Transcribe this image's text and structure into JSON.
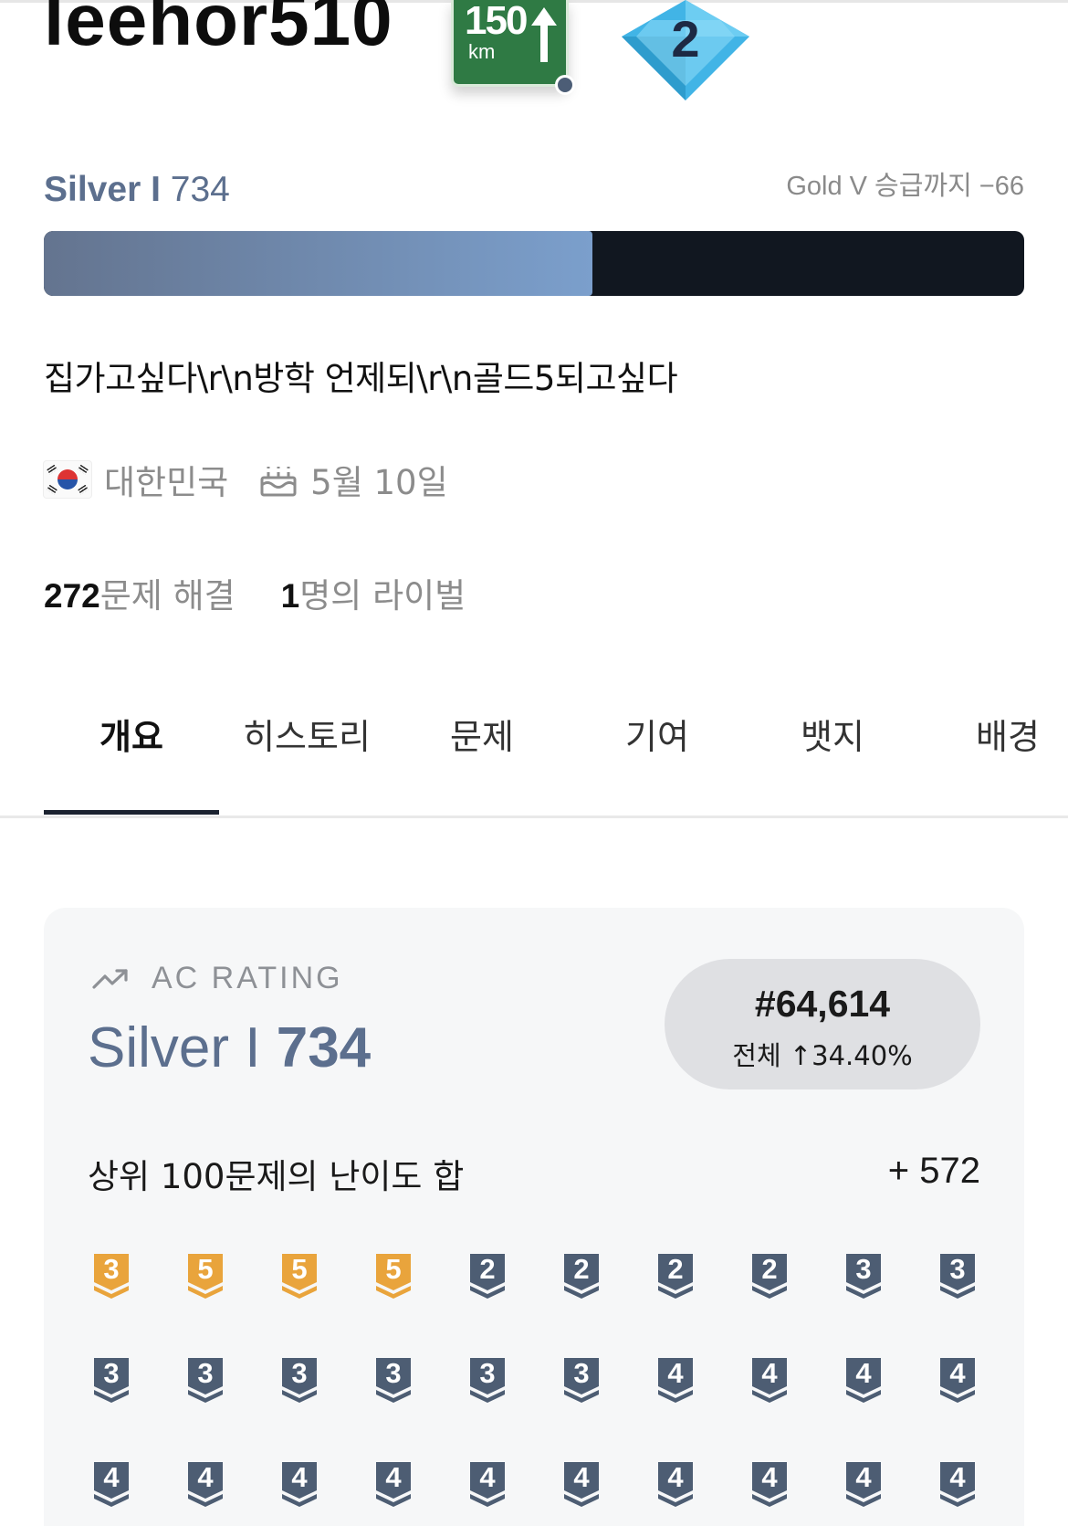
{
  "profile": {
    "handle": "leehor510",
    "sign_number": "150",
    "sign_unit": "km",
    "badge_level": "2",
    "tier_name": "Silver I",
    "rating": "734",
    "promotion_text": "Gold V 승급까지 −66",
    "rating_progress": 0.56,
    "bio": "집가고싶다\\r\\n방학 언제되\\r\\n골드5되고싶다",
    "country": "대한민국",
    "birthday": "5월 10일",
    "solved_count": "272",
    "solved_label": "문제 해결",
    "rival_count": "1",
    "rival_label": "명의 라이벌"
  },
  "tabs": [
    {
      "label": "개요"
    },
    {
      "label": "히스토리"
    },
    {
      "label": "문제"
    },
    {
      "label": "기여"
    },
    {
      "label": "뱃지"
    },
    {
      "label": "배경"
    }
  ],
  "rating_card": {
    "header": "AC RATING",
    "tier_name": "Silver I",
    "rating": "734",
    "rank": "#64,614",
    "rank_detail": "전체 ↑34.40%",
    "top100_label": "상위 100문제의 난이도 합",
    "top100_value": "+ 572",
    "problem_tiers": [
      {
        "tier": "gold",
        "level": "3"
      },
      {
        "tier": "gold",
        "level": "5"
      },
      {
        "tier": "gold",
        "level": "5"
      },
      {
        "tier": "gold",
        "level": "5"
      },
      {
        "tier": "silver",
        "level": "2"
      },
      {
        "tier": "silver",
        "level": "2"
      },
      {
        "tier": "silver",
        "level": "2"
      },
      {
        "tier": "silver",
        "level": "2"
      },
      {
        "tier": "silver",
        "level": "3"
      },
      {
        "tier": "silver",
        "level": "3"
      },
      {
        "tier": "silver",
        "level": "3"
      },
      {
        "tier": "silver",
        "level": "3"
      },
      {
        "tier": "silver",
        "level": "3"
      },
      {
        "tier": "silver",
        "level": "3"
      },
      {
        "tier": "silver",
        "level": "3"
      },
      {
        "tier": "silver",
        "level": "3"
      },
      {
        "tier": "silver",
        "level": "4"
      },
      {
        "tier": "silver",
        "level": "4"
      },
      {
        "tier": "silver",
        "level": "4"
      },
      {
        "tier": "silver",
        "level": "4"
      },
      {
        "tier": "silver",
        "level": "4"
      },
      {
        "tier": "silver",
        "level": "4"
      },
      {
        "tier": "silver",
        "level": "4"
      },
      {
        "tier": "silver",
        "level": "4"
      },
      {
        "tier": "silver",
        "level": "4"
      },
      {
        "tier": "silver",
        "level": "4"
      },
      {
        "tier": "silver",
        "level": "4"
      },
      {
        "tier": "silver",
        "level": "4"
      },
      {
        "tier": "silver",
        "level": "4"
      },
      {
        "tier": "silver",
        "level": "4"
      }
    ]
  },
  "colors": {
    "silver_text": "#5c6f8e",
    "gold_badge": "#e9a43c",
    "silver_badge": "#4d5d73",
    "sign_green": "#2f7a44",
    "diamond_blue": "#41b4e6"
  },
  "icons": {
    "trend": "trending-up-icon",
    "cake": "cake-icon",
    "flag": "korea-flag-icon"
  }
}
